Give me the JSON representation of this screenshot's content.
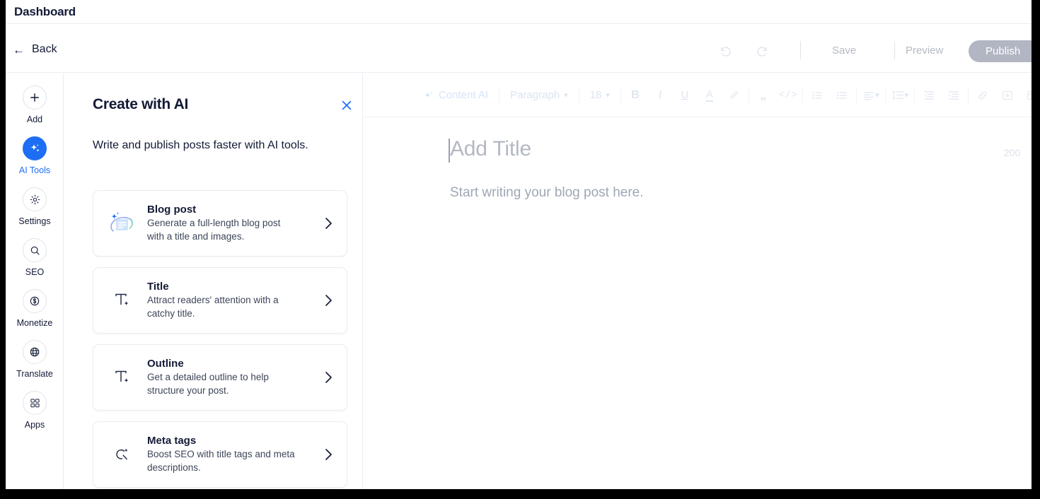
{
  "dashboard": {
    "title": "Dashboard"
  },
  "header": {
    "back_label": "Back",
    "undo_icon": "undo-icon",
    "redo_icon": "redo-icon",
    "save_label": "Save",
    "preview_label": "Preview",
    "publish_label": "Publish"
  },
  "sidebar": {
    "items": [
      {
        "label": "Add",
        "icon": "plus-icon",
        "active": false
      },
      {
        "label": "AI Tools",
        "icon": "sparkle-icon",
        "active": true
      },
      {
        "label": "Settings",
        "icon": "gear-icon",
        "active": false
      },
      {
        "label": "SEO",
        "icon": "search-icon",
        "active": false
      },
      {
        "label": "Monetize",
        "icon": "dollar-icon",
        "active": false
      },
      {
        "label": "Translate",
        "icon": "globe-icon",
        "active": false
      },
      {
        "label": "Apps",
        "icon": "grid-icon",
        "active": false
      }
    ]
  },
  "ai_panel": {
    "title": "Create with AI",
    "subtitle": "Write and publish posts faster with AI tools.",
    "close_icon": "close-icon",
    "accent_color": "#1d6ef5",
    "cards": [
      {
        "title": "Blog post",
        "desc": "Generate a full-length blog post with a title and images.",
        "icon": "document-sparkle-icon"
      },
      {
        "title": "Title",
        "desc": "Attract readers' attention with a catchy title.",
        "icon": "text-sparkle-icon"
      },
      {
        "title": "Outline",
        "desc": "Get a detailed outline to help structure your post.",
        "icon": "text-sparkle-icon"
      },
      {
        "title": "Meta tags",
        "desc": "Boost SEO with title tags and meta descriptions.",
        "icon": "magnifier-sparkle-icon"
      }
    ]
  },
  "editor": {
    "toolbar": {
      "content_ai_label": "Content AI",
      "paragraph_label": "Paragraph",
      "font_size_value": "18",
      "bold_label": "B",
      "italic_label": "I",
      "underline_label": "U",
      "text_color_label": "A",
      "highlight_icon": "highlighter-icon",
      "quote_icon": "quote-icon",
      "code_icon": "code-icon",
      "ordered_list_icon": "ordered-list-icon",
      "bullet_list_icon": "bullet-list-icon",
      "align_icon": "align-left-icon",
      "line_height_icon": "line-height-icon",
      "outdent_icon": "outdent-icon",
      "indent_icon": "indent-icon",
      "link_icon": "link-icon",
      "insert_icon": "insert-element-icon",
      "table_icon": "table-icon"
    },
    "title_placeholder": "Add Title",
    "char_counter": "200",
    "body_placeholder": "Start writing your blog post here."
  }
}
